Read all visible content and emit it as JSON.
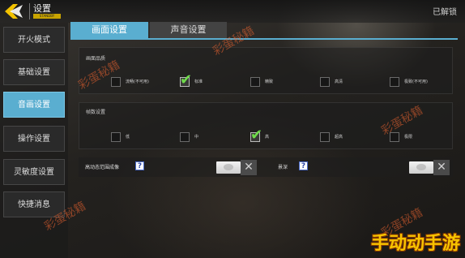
{
  "header": {
    "title": "设置",
    "tag": "STANDBY",
    "logo_icon": "back-arrow-logo-icon",
    "right_text": "已解锁"
  },
  "sidebar": {
    "items": [
      {
        "label": "开火模式",
        "active": false
      },
      {
        "label": "基础设置",
        "active": false
      },
      {
        "label": "音画设置",
        "active": true
      },
      {
        "label": "操作设置",
        "active": false
      },
      {
        "label": "灵敏度设置",
        "active": false
      },
      {
        "label": "快捷消息",
        "active": false
      }
    ]
  },
  "tabs": [
    {
      "label": "画面设置",
      "active": true
    },
    {
      "label": "声音设置",
      "active": false
    }
  ],
  "quality": {
    "title": "画面品质",
    "options": [
      {
        "label": "流畅(不可用)",
        "checked": false
      },
      {
        "label": "标准",
        "checked": true
      },
      {
        "label": "精致",
        "checked": false
      },
      {
        "label": "高清",
        "checked": false
      },
      {
        "label": "极致(不可用)",
        "checked": false
      }
    ]
  },
  "framerate": {
    "title": "帧数设置",
    "options": [
      {
        "label": "低",
        "checked": false
      },
      {
        "label": "中",
        "checked": false
      },
      {
        "label": "高",
        "checked": true
      },
      {
        "label": "超高",
        "checked": false
      },
      {
        "label": "极限",
        "checked": false
      }
    ]
  },
  "toggles": {
    "hdr_label": "高动态范围成像",
    "hdr_help": "?",
    "hdr_off": "✕",
    "dof_label": "景深",
    "dof_help": "?",
    "dof_off": "✕"
  },
  "watermarks": {
    "text": "彩蛋秘籍",
    "corner": "手动动手游"
  },
  "colors": {
    "accent": "#5aaed0",
    "check": "#6fdc4a",
    "tag": "#c9a400"
  }
}
